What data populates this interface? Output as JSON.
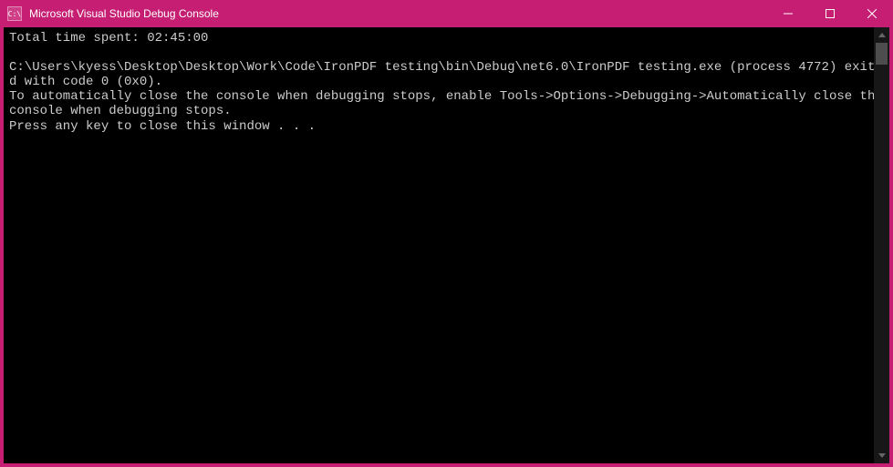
{
  "window": {
    "title": "Microsoft Visual Studio Debug Console",
    "icon_label": "C:\\"
  },
  "console": {
    "lines": [
      "Total time spent: 02:45:00",
      "",
      "C:\\Users\\kyess\\Desktop\\Desktop\\Work\\Code\\IronPDF testing\\bin\\Debug\\net6.0\\IronPDF testing.exe (process 4772) exited with code 0 (0x0).",
      "To automatically close the console when debugging stops, enable Tools->Options->Debugging->Automatically close the console when debugging stops.",
      "Press any key to close this window . . ."
    ]
  }
}
